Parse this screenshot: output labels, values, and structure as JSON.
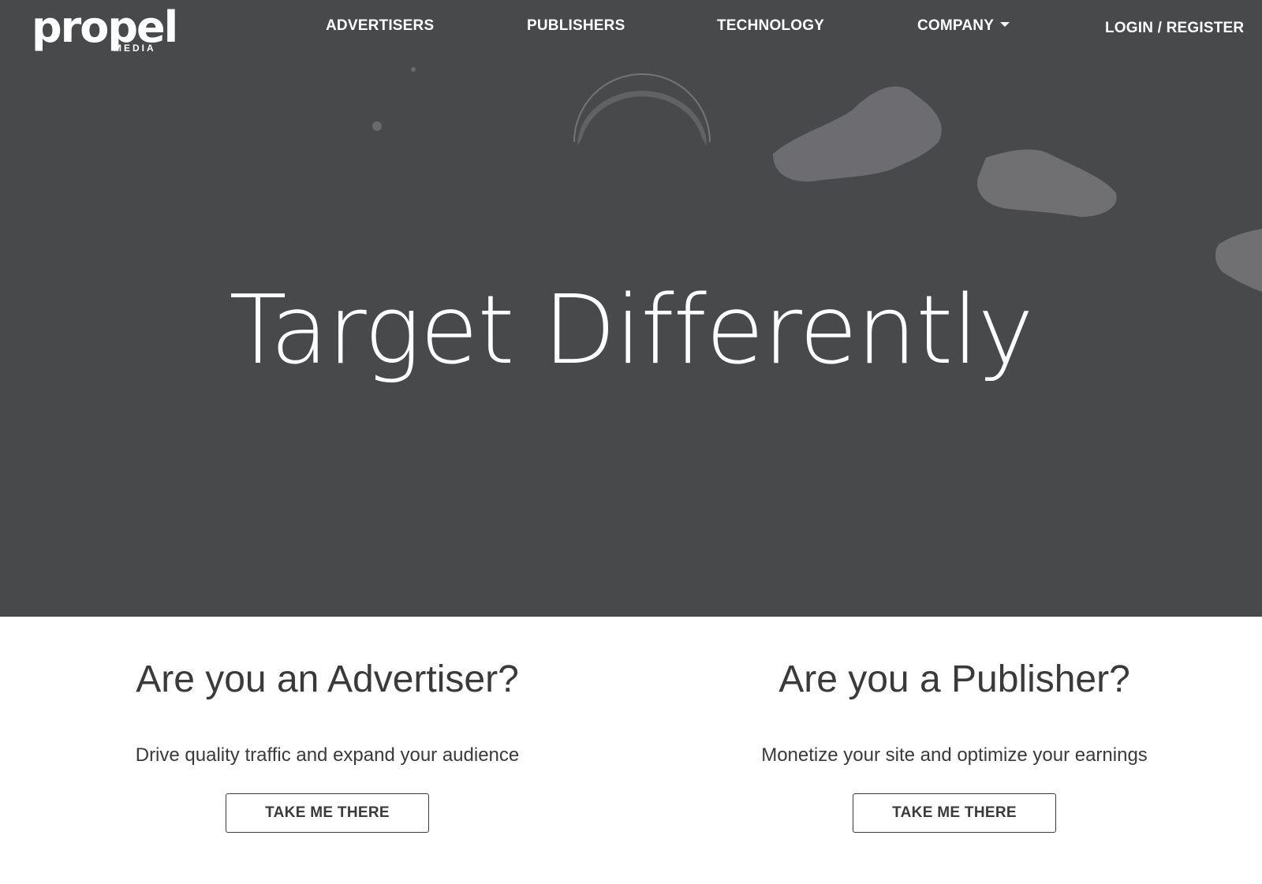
{
  "brand": {
    "logo_text": "propel",
    "logo_sub": "MEDIA"
  },
  "nav": {
    "advertisers": "ADVERTISERS",
    "publishers": "PUBLISHERS",
    "technology": "TECHNOLOGY",
    "company": "COMPANY",
    "login": "LOGIN / REGISTER"
  },
  "hero": {
    "title": "Target Differently"
  },
  "advertiser_card": {
    "title": "Are you an Advertiser?",
    "description": "Drive quality traffic and expand your audience",
    "button": "TAKE ME THERE"
  },
  "publisher_card": {
    "title": "Are you a Publisher?",
    "description": "Monetize your site and optimize your earnings",
    "button": "TAKE ME THERE"
  },
  "colors": {
    "hero_bg": "#48494b",
    "text_dark": "#3a3a3c",
    "white": "#ffffff"
  },
  "icons": {
    "company_dropdown": "chevron-down-icon"
  }
}
